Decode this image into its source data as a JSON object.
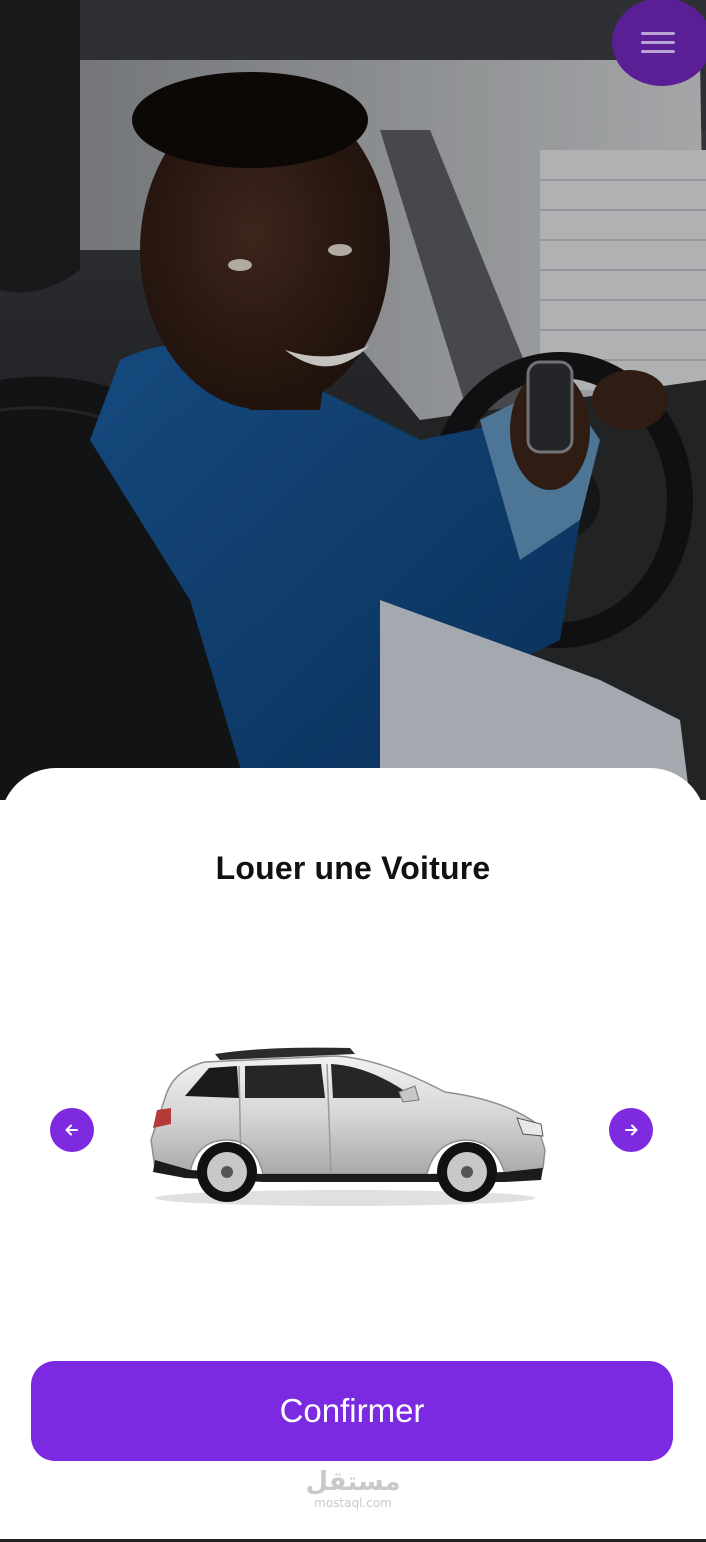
{
  "hero": {
    "image_label": "man-smiling-in-car-holding-key"
  },
  "menu": {
    "icon": "hamburger-icon",
    "color": "#5a1e95"
  },
  "title": {
    "prefix": "Louer une ",
    "emphasis": "Voiture"
  },
  "carousel": {
    "image_label": "silver-suv-side-view",
    "prev_icon": "arrow-left-icon",
    "next_icon": "arrow-right-icon",
    "accent": "#7d2ae0"
  },
  "actions": {
    "confirm_label": "Confirmer",
    "accent": "#7b2ae2"
  },
  "watermark": {
    "arabic": "مستقل",
    "latin": "mostaql.com"
  }
}
